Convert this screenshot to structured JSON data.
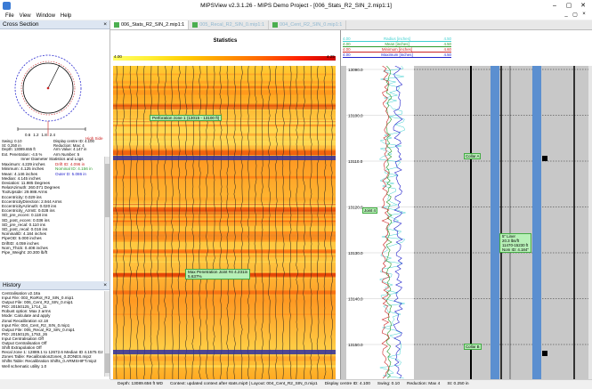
{
  "window": {
    "title": "MIPSView v2.3.1.26 - MIPS Demo Project - [006_Stats_R2_SIN_2.mip1:1]"
  },
  "menu": [
    "File",
    "View",
    "Window",
    "Help"
  ],
  "mdi_controls": [
    "_",
    "▢",
    "×"
  ],
  "cross_section": {
    "title": "Cross Section",
    "high_side": "High Side",
    "scale": [
      "0.6",
      "1.2",
      "1.8",
      "2.4"
    ],
    "params_left": [
      "Swing: 0.10",
      "St: 0.250 in",
      "Depth: 13089.655 ft",
      "Ext. Penetration: -4.5 %"
    ],
    "params_right": [
      "Display centre ID: 4.100",
      "Reduction: Max: 4",
      "Arm Value: 4.147 in",
      "Arm Number: 5"
    ]
  },
  "stats": {
    "heading": "Inner Diameter Statistics and Logs",
    "rows": [
      [
        "Maximum: 4.229 inches",
        "Drift ID: 4.096 in"
      ],
      [
        "Minimum: 4.125 inches",
        "Nominal ID: 4.156 in"
      ],
      [
        "Mean: 4.146 inches",
        "Outer D: 5.086 in"
      ],
      [
        "Median: 4.145 inches",
        ""
      ],
      [
        "Deviation: 11.985 Degrees",
        ""
      ],
      [
        "RelatAzimuth: 260.071 Degrees",
        ""
      ],
      [
        "ToolUpside: 29.986 Arms",
        ""
      ],
      [
        "Eccentricity: 0.029 ins",
        ""
      ],
      [
        "EccentricityDirection: 2.944 Arms",
        ""
      ],
      [
        "EccentricityAzimuth: 0.020 ins",
        ""
      ],
      [
        "Eccentricity_AzmE: 0.028 ins",
        ""
      ],
      [
        "SD_pre_eccen: 0.118 ins",
        ""
      ],
      [
        "SD_post_eccen: 0.036 ins",
        ""
      ],
      [
        "SD_pre_recal: 0.110 ins",
        ""
      ],
      [
        "SD_post_recal: 0.016 ins",
        ""
      ],
      [
        "NominalID: 4.184 inches",
        ""
      ],
      [
        "PipeOD: 5.000 inches",
        ""
      ],
      [
        "DriftID: 4.059 inches",
        ""
      ],
      [
        "Nom_Thick: 0.408 inches",
        ""
      ],
      [
        "Pipe_Weight: 20.300 lb/ft",
        ""
      ]
    ]
  },
  "history": {
    "title": "History",
    "lines": [
      "Centralisation v2.18a",
      "  Input File: 003_RoiRot_R2_SIN_0.mip1",
      "  Output File: 006_Cent_R2_SIN_0.mip1",
      "  PID: 20150125_1714_11",
      "  Robust option: Max 2 arms",
      "  Mode: Calculate and apply",
      "Zonal Recalibration v2.18",
      "  Input File: 004_Cent_R2_SIN_0.mip1",
      "  Output File: 005_Recal_R2_SIN_0.mip1",
      "  PID: 20150125_1753_26",
      "  Input Centralisation Off",
      "  Output Centralisation Off",
      "  Shift Extrapolation Off",
      "  Recal zone 1: 12889.1 to 12672.6 Median ID 4.1575 Gz",
      "  Zones Table: RecalibrationZones_0.ZONES.mip2",
      "  Shifts Table: Recalibration Shifts_0.ARMSHIFT.mip2",
      "Well schematic utility 1.0"
    ]
  },
  "tabs": [
    {
      "label": "006_Stats_R2_SIN_2.mip1:1",
      "active": true
    },
    {
      "label": "005_Recal_R2_SIN_0.mip1:1",
      "active": false
    },
    {
      "label": "004_Cent_R2_SIN_0.mip1:1",
      "active": false
    }
  ],
  "statistics_pane": {
    "label": "Statistics",
    "scale_min": "4.00",
    "scale_max": "4.25"
  },
  "annotations": {
    "perf_zone": "Perforation zone 1 (13015 - 13100 ft)",
    "max_pen_line1": "Max Penetration Joint #4 4.231in",
    "max_pen_line2": "5.637%",
    "collar_a": "Collar A",
    "collar_b": "Collar B",
    "joint": "Joint 4",
    "liner_lines": [
      "5\" Liner",
      "20.3 lbs/ft",
      "11470-15230 ft",
      "Nom ID: 4.184\""
    ]
  },
  "depth_ticks": [
    "13090.0",
    "13100.0",
    "13110.0",
    "13120.0",
    "13130.0",
    "13140.0",
    "13150.0"
  ],
  "log_legend": [
    {
      "min": "4.00",
      "name": "Radius [inches]",
      "max": "4.50",
      "color": "#3fd0d0"
    },
    {
      "min": "4.00",
      "name": "Mean [inches]",
      "max": "4.50",
      "color": "#2a9a2a"
    },
    {
      "min": "4.00",
      "name": "Minimum [inches]",
      "max": "4.60",
      "color": "#cc2222"
    },
    {
      "min": "4.00",
      "name": "Maximum [inches]",
      "max": "4.50",
      "color": "#2222cc"
    }
  ],
  "status": {
    "depth": "Depth: 13089.656 ft MD",
    "context": "Context: updated context after stats.mip0 | Layout: 004_Cent_R2_SIN_0.mip1",
    "display": "Display centre ID: 4.100",
    "swing": "Swing: 0.10",
    "reduction": "Reduction: Max 4",
    "st": "St: 0.250 in"
  },
  "colors": {
    "accent": "#3a7bd5",
    "casing": "#5b8fd0",
    "label_bg": "#b7f0b7",
    "track_bg": "#c8c8c8"
  }
}
